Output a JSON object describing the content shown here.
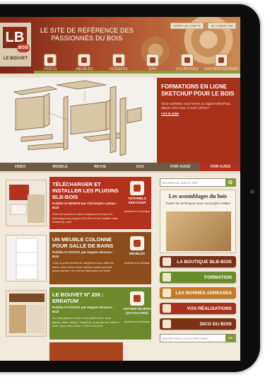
{
  "header": {
    "tagline": "LE SITE DE RÉFÉRENCE DES PASSIONNÉS DU BOIS",
    "logo_letters": "LB",
    "logo_badge": "BOIS",
    "logo_name": "LE BOUVET",
    "top_links": [
      "CRÉER UN COMPTE",
      "SE CONNECTER"
    ]
  },
  "nav": {
    "items": [
      {
        "label": "VIDÉOS",
        "icon": "video-icon"
      },
      {
        "label": "MEUBLES",
        "icon": "furniture-icon"
      },
      {
        "label": "DOSSIERS",
        "icon": "folder-icon"
      },
      {
        "label": "DAO",
        "icon": "computer-icon"
      },
      {
        "label": "LES REVUES",
        "icon": "magazine-icon"
      },
      {
        "label": "VOS RÉALISATIONS",
        "icon": "project-icon"
      }
    ]
  },
  "hero": {
    "title": "FORMATIONS EN LIGNE SKETCHUP POUR LE BOIS",
    "text": "Vous souhaitez vous former au logiciel SketchUp, depuis chez vous, à votre rythme?",
    "link": "Lire la suite"
  },
  "subnav": {
    "items": [
      "VIDÉO",
      "MODÈLE",
      "REVUE",
      "DAO",
      "VOIR AUSSI",
      "VOIR AUSSI"
    ]
  },
  "cards": [
    {
      "title": "TÉLÉCHARGER ET INSTALLER LES PLUGINS BLB-BOIS",
      "meta": "Publiée le 05/08/19 par Christophe Lahaye - BLB",
      "text": "Voici ces plusieurs vidéos expliquant la façon de télécharger les plugins BLB-Bois et les installer dans SketchUp, pour",
      "side_label": "TUTORIELS SKETCHUP",
      "side_link": "Accéder à la rubrique"
    },
    {
      "title": "UN MEUBLE COLONNE POUR SALLE DE BAINS",
      "meta": "Publiée le 07/01/21 par Hugues Nivesse - BLB",
      "text": "Voici un petit meuble de rangement pour salle de bains, sous forme d'une colonne contemporaine passe-partout, au coût de fabrication est faible.",
      "side_label": "MEUBLES",
      "side_link": "Accéder à la rubrique"
    },
    {
      "title": "LE BOUVET N° 206 : ERRATUM",
      "meta": "Publiée le 07/01/21 par Hugues Nivesse - BLB",
      "text": "On n'est jamais à l'abri ! Une petite erreur s'est glissée dans l'article \"Travail de la courbe aux outils à main\" paru dans notre n° 206 du Bouvet",
      "side_label": "AUTOUR DU BOIS (ACTUALITÉS)",
      "side_link": "Accéder à la rubrique"
    },
    {
      "title": ""
    }
  ],
  "sidebar": {
    "search_placeholder": "RECHERCHE SUR LE SITE",
    "search_button": "Q",
    "promo_title": "Les assemblages du bois",
    "promo_sub": "Toutes les techniques pour vos projets solides",
    "buttons": [
      "LA BOUTIQUE BLB-BOIS",
      "FORMATION",
      "LES BONNES ADRESSES",
      "VOS RÉALISATIONS",
      "DICO DU BOIS"
    ],
    "newsletter_placeholder": "INSCRIPTION À LA LETTRE D'INFO",
    "newsletter_button": "OK"
  }
}
